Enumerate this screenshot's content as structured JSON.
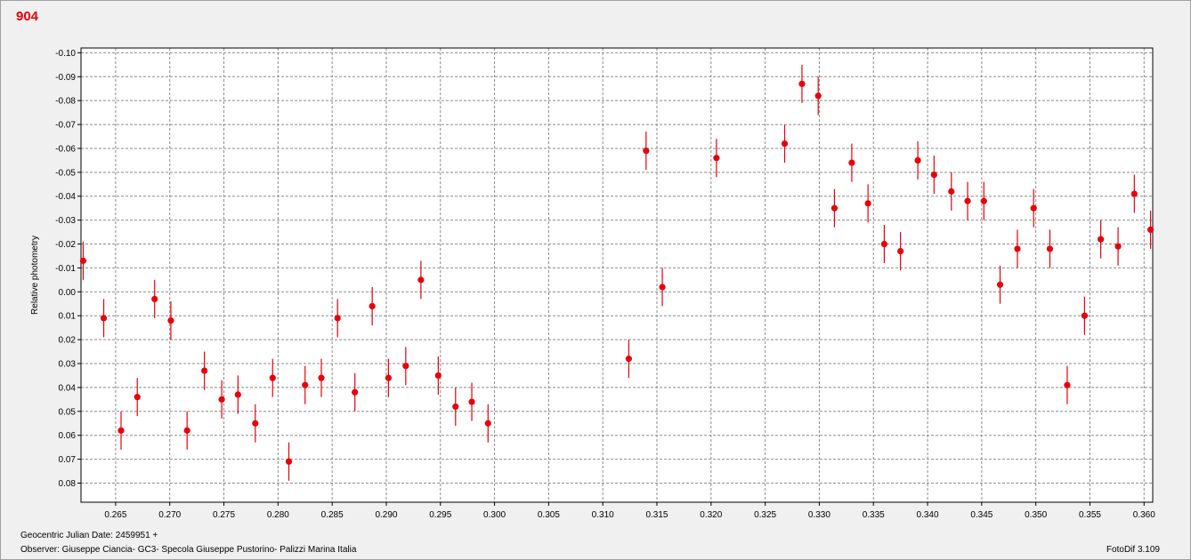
{
  "header": {
    "title": "904"
  },
  "footer": {
    "date_label": "Geocentric Julian Date: 2459951 +",
    "observer": "Observer: Giuseppe Ciancia- GC3- Specola Giuseppe Pustorino- Palizzi Marina Italia",
    "software": "FotoDif 3.109"
  },
  "colors": {
    "points": "#e8000b",
    "title": "#e8000b",
    "grid": "#8c8c8c",
    "background": "#ffffff"
  },
  "chart_data": {
    "type": "scatter",
    "title": "904",
    "xlabel": "",
    "ylabel": "Relative photometry",
    "xlim": [
      0.2618,
      0.3608
    ],
    "ylim": [
      -0.102,
      0.088
    ],
    "y_inverted": true,
    "grid": true,
    "xticks": [
      0.265,
      0.27,
      0.275,
      0.28,
      0.285,
      0.29,
      0.295,
      0.3,
      0.305,
      0.31,
      0.315,
      0.32,
      0.325,
      0.33,
      0.335,
      0.34,
      0.345,
      0.35,
      0.355,
      0.36
    ],
    "xtick_labels": [
      "0.265",
      "0.270",
      "0.275",
      "0.280",
      "0.285",
      "0.290",
      "0.295",
      "0.300",
      "0.305",
      "0.310",
      "0.315",
      "0.320",
      "0.325",
      "0.330",
      "0.335",
      "0.340",
      "0.345",
      "0.350",
      "0.355",
      "0.360"
    ],
    "yticks": [
      -0.1,
      -0.09,
      -0.08,
      -0.07,
      -0.06,
      -0.05,
      -0.04,
      -0.03,
      -0.02,
      -0.01,
      0.0,
      0.01,
      0.02,
      0.03,
      0.04,
      0.05,
      0.06,
      0.07,
      0.08
    ],
    "ytick_labels": [
      "-0.10",
      "-0.09",
      "-0.08",
      "-0.07",
      "-0.06",
      "-0.05",
      "-0.04",
      "-0.03",
      "-0.02",
      "-0.01",
      "0.00",
      "0.01",
      "0.02",
      "0.03",
      "0.04",
      "0.05",
      "0.06",
      "0.07",
      "0.08"
    ],
    "error": 0.008,
    "points": [
      [
        0.262,
        -0.013
      ],
      [
        0.2639,
        0.011
      ],
      [
        0.2655,
        0.058
      ],
      [
        0.267,
        0.044
      ],
      [
        0.2686,
        0.003
      ],
      [
        0.2701,
        0.012
      ],
      [
        0.2716,
        0.058
      ],
      [
        0.2732,
        0.033
      ],
      [
        0.2748,
        0.045
      ],
      [
        0.2763,
        0.043
      ],
      [
        0.2779,
        0.055
      ],
      [
        0.2795,
        0.036
      ],
      [
        0.281,
        0.071
      ],
      [
        0.2825,
        0.039
      ],
      [
        0.284,
        0.036
      ],
      [
        0.2855,
        0.011
      ],
      [
        0.2871,
        0.042
      ],
      [
        0.2887,
        0.006
      ],
      [
        0.2902,
        0.036
      ],
      [
        0.2918,
        0.031
      ],
      [
        0.2932,
        -0.005
      ],
      [
        0.2948,
        0.035
      ],
      [
        0.2964,
        0.048
      ],
      [
        0.2979,
        0.046
      ],
      [
        0.2994,
        0.055
      ],
      [
        0.3124,
        0.028
      ],
      [
        0.314,
        -0.059
      ],
      [
        0.3155,
        -0.002
      ],
      [
        0.3205,
        -0.056
      ],
      [
        0.3268,
        -0.062
      ],
      [
        0.3284,
        -0.087
      ],
      [
        0.3299,
        -0.082
      ],
      [
        0.3314,
        -0.035
      ],
      [
        0.333,
        -0.054
      ],
      [
        0.3345,
        -0.037
      ],
      [
        0.336,
        -0.02
      ],
      [
        0.3375,
        -0.017
      ],
      [
        0.3391,
        -0.055
      ],
      [
        0.3406,
        -0.049
      ],
      [
        0.3422,
        -0.042
      ],
      [
        0.3437,
        -0.038
      ],
      [
        0.3452,
        -0.038
      ],
      [
        0.3467,
        -0.003
      ],
      [
        0.3483,
        -0.018
      ],
      [
        0.3498,
        -0.035
      ],
      [
        0.3513,
        -0.018
      ],
      [
        0.3529,
        0.039
      ],
      [
        0.3545,
        0.01
      ],
      [
        0.356,
        -0.022
      ],
      [
        0.3576,
        -0.019
      ],
      [
        0.3591,
        -0.041
      ],
      [
        0.3606,
        -0.026
      ]
    ]
  }
}
